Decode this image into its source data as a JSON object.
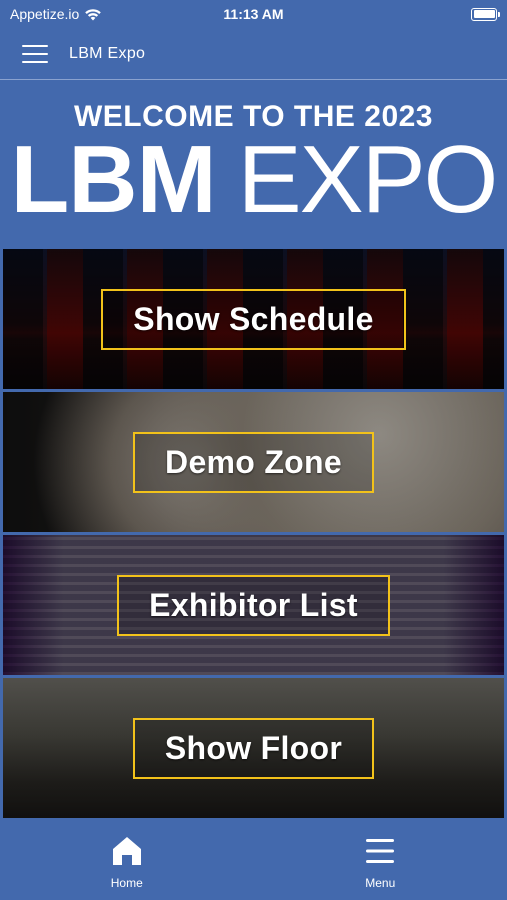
{
  "status_bar": {
    "carrier": "Appetize.io",
    "time": "11:13 AM"
  },
  "header": {
    "title": "LBM Expo",
    "menu_icon": "hamburger-menu-icon"
  },
  "banner": {
    "welcome": "WELCOME TO THE 2023",
    "logo_bold": "LBM",
    "logo_light": "EXPO"
  },
  "tiles": [
    {
      "label": "Show Schedule"
    },
    {
      "label": "Demo Zone"
    },
    {
      "label": "Exhibitor List"
    },
    {
      "label": "Show Floor"
    }
  ],
  "tab_bar": {
    "items": [
      {
        "label": "Home",
        "icon": "home-icon"
      },
      {
        "label": "Menu",
        "icon": "menu-icon"
      }
    ]
  },
  "colors": {
    "brand_blue": "#4369ad",
    "accent_yellow": "#f2c21a"
  }
}
